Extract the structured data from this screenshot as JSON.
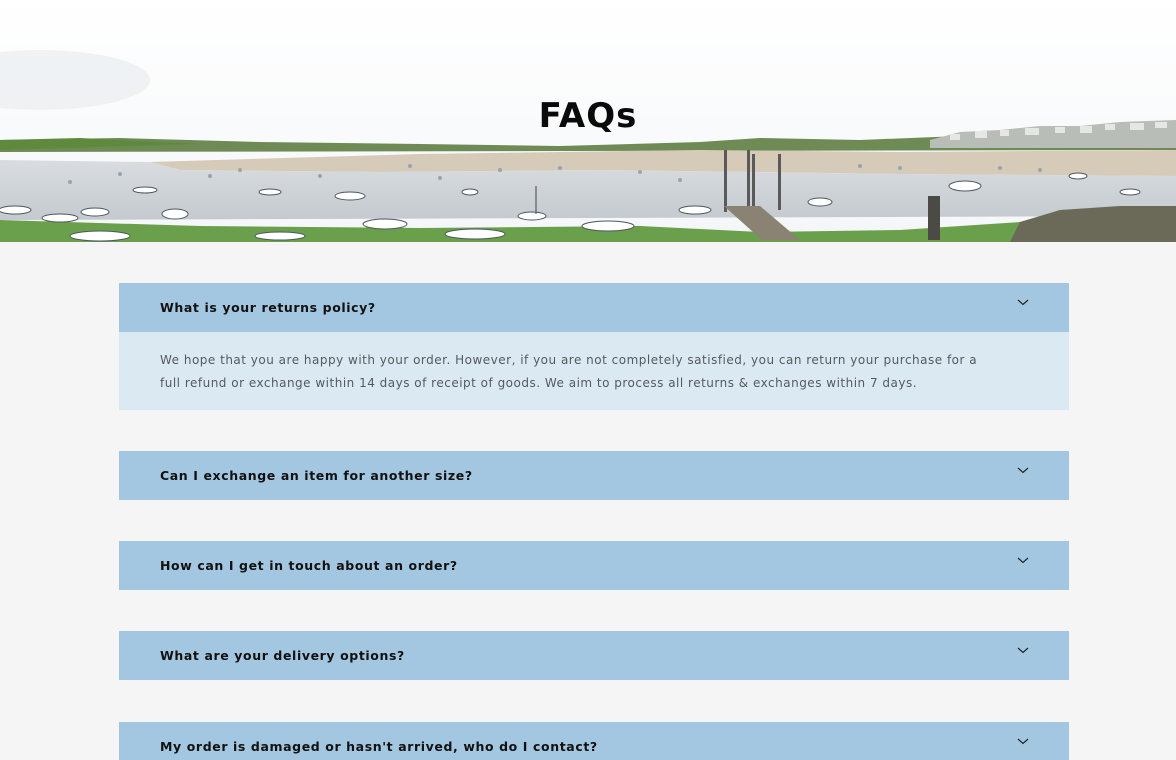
{
  "page": {
    "title": "FAQs"
  },
  "colors": {
    "question_bg": "#a3c7e0",
    "answer_bg": "#dbe9f3",
    "page_bg": "#f5f5f6"
  },
  "faqs": [
    {
      "question": "What is your returns policy?",
      "answer": "We hope that you are happy with your order. However, if you are not completely satisfied, you can return your purchase for a full refund or exchange within 14 days of receipt of goods. We aim to process all returns & exchanges within 7 days.",
      "expanded": true
    },
    {
      "question": "Can I exchange an item for another size?",
      "expanded": false
    },
    {
      "question": "How can I get in touch about an order?",
      "expanded": false
    },
    {
      "question": "What are your delivery options?",
      "expanded": false
    },
    {
      "question": "My order is damaged or hasn't arrived, who do I contact?",
      "expanded": false
    }
  ],
  "icons": {
    "toggle": "chevron-down-icon"
  }
}
